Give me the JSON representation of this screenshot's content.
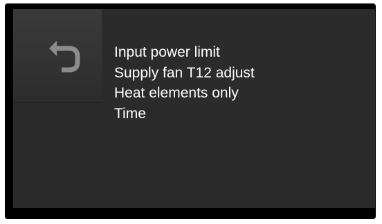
{
  "screen": {
    "back_button": {
      "icon": "back-arrow-icon",
      "icon_color": "#8c8c8c"
    },
    "menu": {
      "items": [
        {
          "label": "Input power limit"
        },
        {
          "label": "Supply fan T12 adjust"
        },
        {
          "label": "Heat elements only"
        },
        {
          "label": "Time"
        }
      ]
    },
    "colors": {
      "background": "#2b2b2b",
      "border": "#000000",
      "text": "#ffffff"
    }
  }
}
